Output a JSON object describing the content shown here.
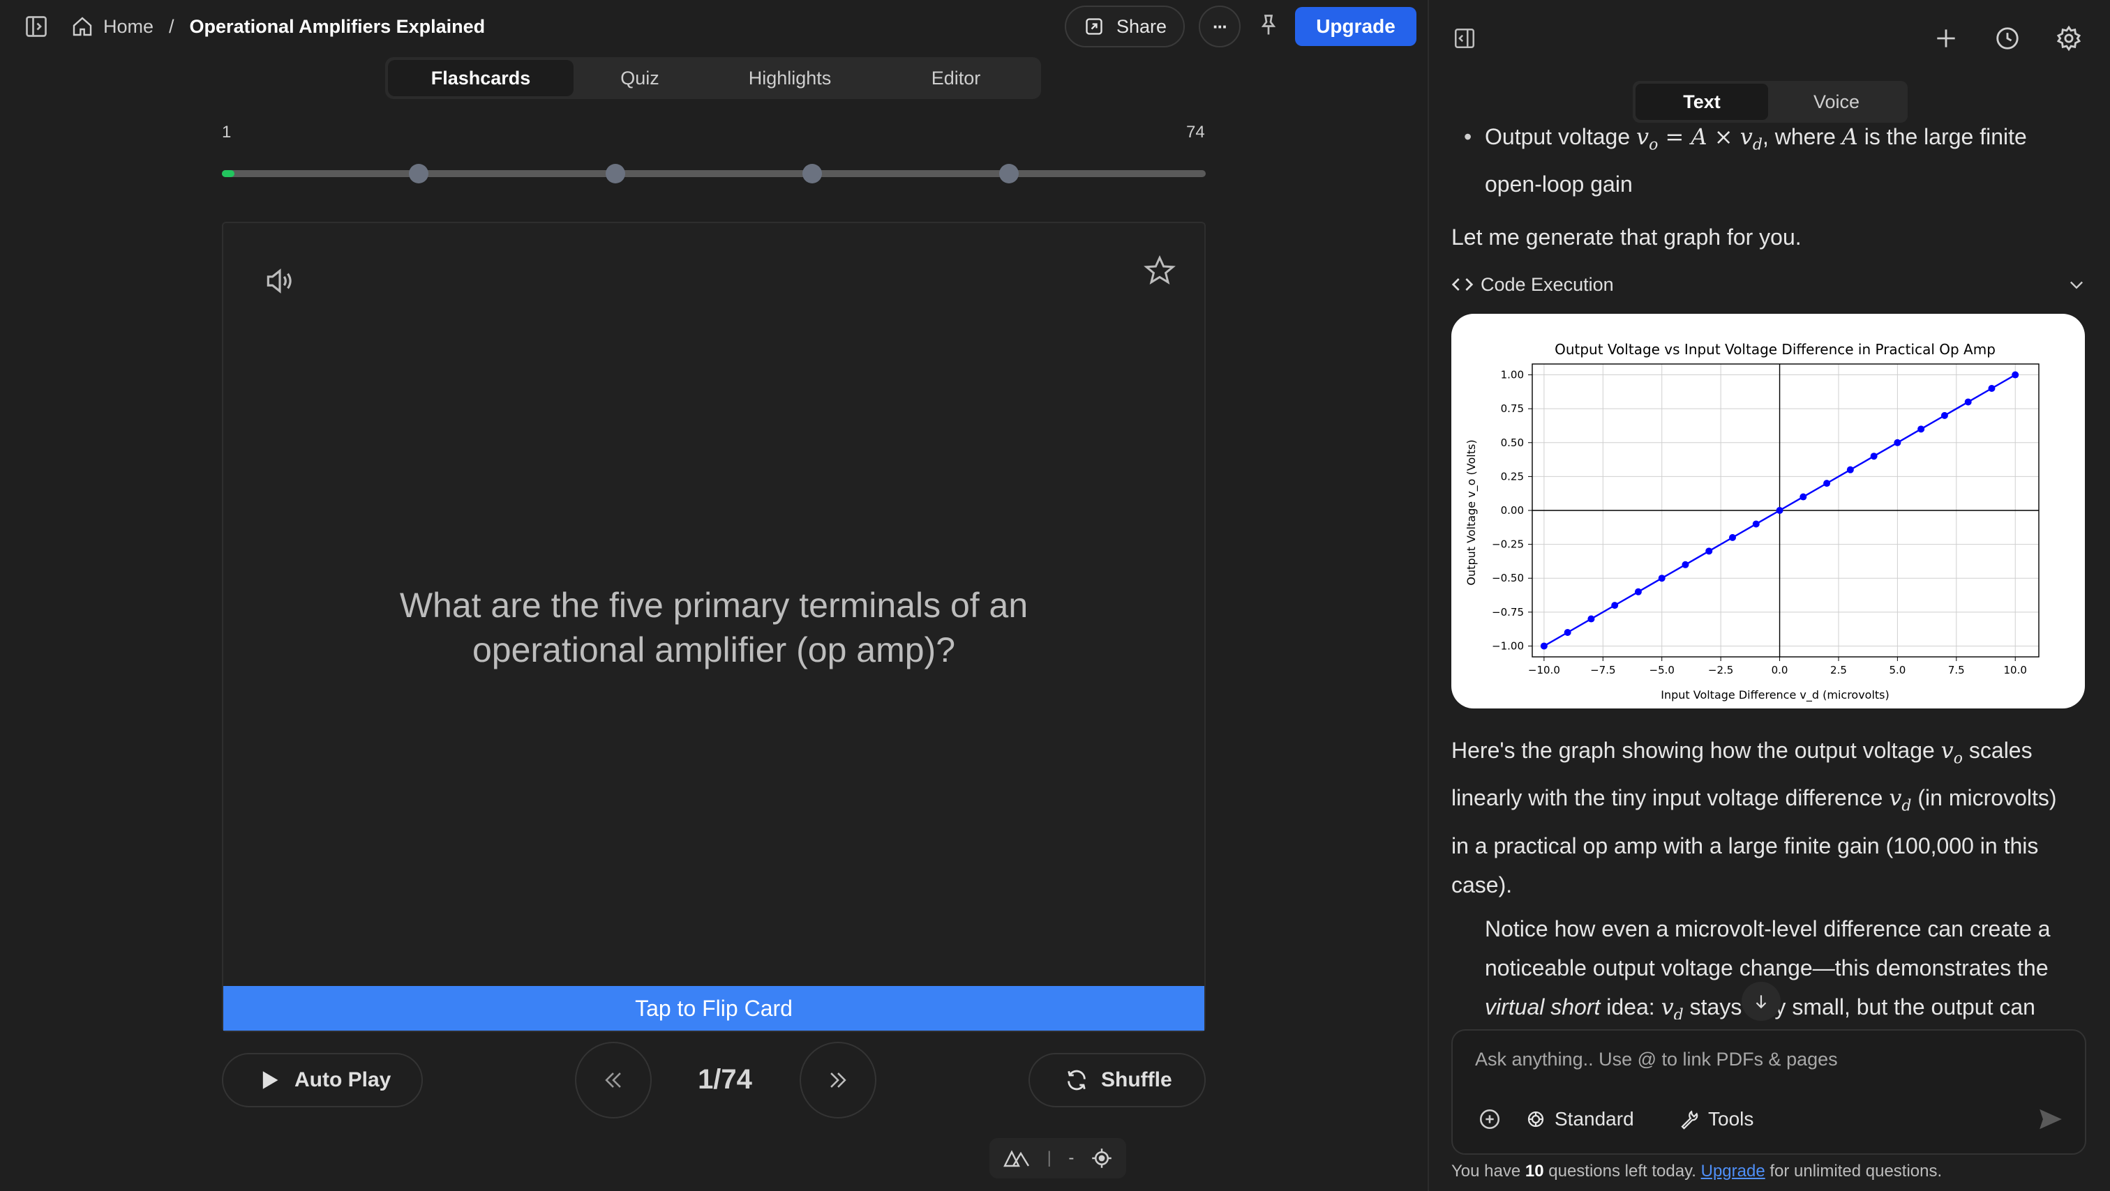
{
  "header": {
    "home_label": "Home",
    "separator": "/",
    "title": "Operational Amplifiers Explained",
    "share_label": "Share",
    "more_label": "···",
    "upgrade_label": "Upgrade"
  },
  "tabs": [
    {
      "label": "Flashcards",
      "active": true
    },
    {
      "label": "Quiz",
      "active": false
    },
    {
      "label": "Highlights",
      "active": false
    },
    {
      "label": "Editor",
      "active": false
    }
  ],
  "progress": {
    "min_label": "1",
    "max_label": "74",
    "current": 1,
    "total": 74,
    "markers": [
      0.2,
      0.4,
      0.6,
      0.8
    ]
  },
  "card": {
    "question_line1": "What are the five primary terminals of an",
    "question_line2": "operational amplifier (op amp)?",
    "flip_label": "Tap to Flip Card"
  },
  "controls": {
    "autoplay_label": "Auto Play",
    "counter": "1/74",
    "shuffle_label": "Shuffle"
  },
  "bottom_toolbar": {
    "sep": "-"
  },
  "right": {
    "mode_tabs": [
      {
        "label": "Text",
        "active": true
      },
      {
        "label": "Voice",
        "active": false
      }
    ],
    "bullet1_line1_pre": "Output voltage ",
    "bullet1_math1": "v",
    "bullet1_math1_sub": "o",
    "bullet1_math_eq": " = A × v",
    "bullet1_math_eq_sub": "d",
    "bullet1_line1_mid": ", where ",
    "bullet1_math_A": "A",
    "bullet1_line1_post": " is the large finite",
    "bullet1_line2": "open-loop gain",
    "para1": "Let me generate that graph for you.",
    "code_exec_label": "Code Execution",
    "para2_l1_pre": "Here's the graph showing how the output voltage ",
    "para2_l1_math": "v",
    "para2_l1_sub": "o",
    "para2_l1_post": " scales",
    "para2_l2_pre": "linearly with the tiny input voltage difference ",
    "para2_l2_math": "v",
    "para2_l2_sub": "d",
    "para2_l2_post": " (in microvolts)",
    "para2_l3": "in a practical op amp with a large finite gain (100,000 in this",
    "para2_l4": "case).",
    "bullet2_l1": "Notice how even a microvolt-level difference can create a",
    "bullet2_l2": "noticeable output voltage change—this demonstrates the",
    "bullet2_l3_italic": "virtual short",
    "bullet2_l3_mid": " idea: ",
    "bullet2_l3_math": "v",
    "bullet2_l3_sub": "d",
    "bullet2_l3_post1": " stays",
    "bullet2_l3_post2": "ly small, but the output can",
    "chat_placeholder": "Ask anything.. Use @ to link PDFs & pages",
    "standard_label": "Standard",
    "tools_label": "Tools",
    "footer_pre": "You have ",
    "footer_count": "10",
    "footer_mid": " questions left today. ",
    "footer_link": "Upgrade",
    "footer_post": " for unlimited questions."
  },
  "chart_data": {
    "type": "line",
    "title": "Output Voltage vs Input Voltage Difference in Practical Op Amp",
    "xlabel": "Input Voltage Difference v_d (microvolts)",
    "ylabel": "Output Voltage v_o (Volts)",
    "xlim": [
      -10.5,
      11.0
    ],
    "ylim": [
      -1.08,
      1.08
    ],
    "xticks": [
      "−10.0",
      "−7.5",
      "−5.0",
      "−2.5",
      "0.0",
      "2.5",
      "5.0",
      "7.5",
      "10.0"
    ],
    "xtick_values": [
      -10,
      -7.5,
      -5,
      -2.5,
      0,
      2.5,
      5,
      7.5,
      10
    ],
    "yticks": [
      "1.00",
      "0.75",
      "0.50",
      "0.25",
      "0.00",
      "−0.25",
      "−0.50",
      "−0.75",
      "−1.00"
    ],
    "ytick_values": [
      1,
      0.75,
      0.5,
      0.25,
      0,
      -0.25,
      -0.5,
      -0.75,
      -1
    ],
    "grid": true,
    "x": [
      -10,
      -9,
      -8,
      -7,
      -6,
      -5,
      -4,
      -3,
      -2,
      -1,
      0,
      1,
      2,
      3,
      4,
      5,
      6,
      7,
      8,
      9,
      10
    ],
    "y": [
      -1.0,
      -0.9,
      -0.8,
      -0.7,
      -0.6,
      -0.5,
      -0.4,
      -0.3,
      -0.2,
      -0.1,
      0.0,
      0.1,
      0.2,
      0.3,
      0.4,
      0.5,
      0.6,
      0.7,
      0.8,
      0.9,
      1.0
    ],
    "color": "#0000ff"
  }
}
